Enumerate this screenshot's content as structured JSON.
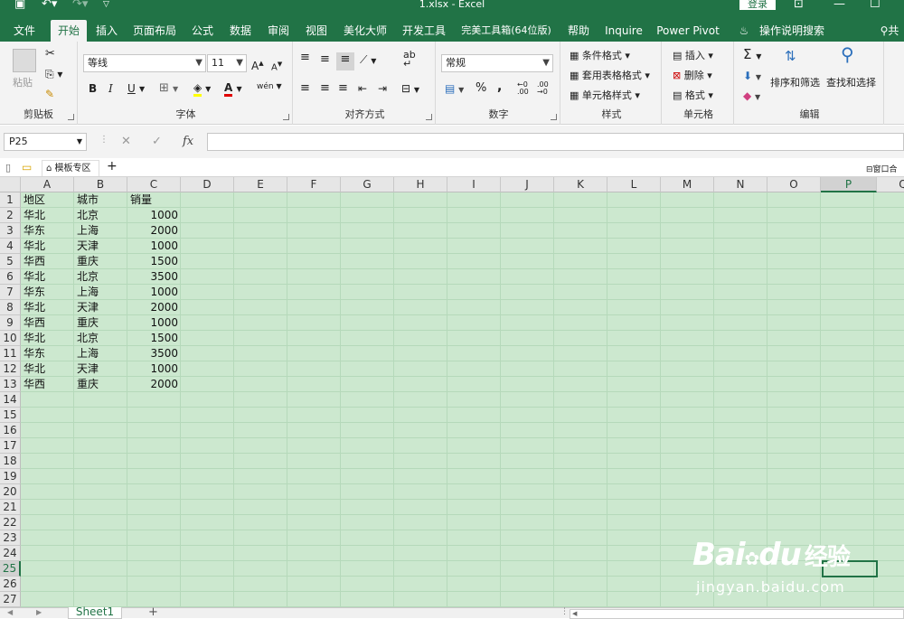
{
  "titlebar": {
    "title": "1.xlsx  -  Excel",
    "login": "登录"
  },
  "menu": {
    "tabs": [
      "文件",
      "开始",
      "插入",
      "页面布局",
      "公式",
      "数据",
      "审阅",
      "视图",
      "美化大师",
      "开发工具",
      "完美工具箱(64位版)",
      "帮助",
      "Inquire",
      "Power Pivot"
    ],
    "active": "开始",
    "search": "操作说明搜索",
    "share": "共"
  },
  "ribbon": {
    "clipboard": {
      "label": "剪贴板",
      "paste": "粘贴"
    },
    "font": {
      "label": "字体",
      "family": "等线",
      "size": "11",
      "bold": "B",
      "italic": "I",
      "underline": "U",
      "grow": "A",
      "shrink": "A",
      "color_letter": "A",
      "phonetic": "wén"
    },
    "alignment": {
      "label": "对齐方式"
    },
    "number": {
      "label": "数字",
      "format": "常规",
      "percent": "%",
      "comma": ","
    },
    "styles": {
      "label": "样式",
      "conditional": "条件格式",
      "table": "套用表格格式",
      "cell": "单元格样式"
    },
    "cells": {
      "label": "单元格",
      "insert": "插入",
      "delete": "删除",
      "format": "格式"
    },
    "editing": {
      "label": "编辑",
      "sort": "排序和筛选",
      "find": "查找和选择"
    }
  },
  "formula_bar": {
    "name_box": "P25",
    "cancel": "✕",
    "enter": "✓",
    "fx": "fx",
    "value": ""
  },
  "doc_bar": {
    "template_tab": "模板专区",
    "new_tab": "+",
    "window_label": "窗口合"
  },
  "sheet": {
    "columns": [
      "A",
      "B",
      "C",
      "D",
      "E",
      "F",
      "G",
      "H",
      "I",
      "J",
      "K",
      "L",
      "M",
      "N",
      "O",
      "P",
      "Q"
    ],
    "selected_column": "P",
    "selected_row": "25",
    "rows": [
      "1",
      "2",
      "3",
      "4",
      "5",
      "6",
      "7",
      "8",
      "9",
      "10",
      "11",
      "12",
      "13",
      "14",
      "15",
      "16",
      "17",
      "18",
      "19",
      "20",
      "21",
      "22",
      "23",
      "24",
      "25",
      "26",
      "27"
    ],
    "headers": [
      "地区",
      "城市",
      "销量"
    ],
    "data": [
      [
        "华北",
        "北京",
        "1000"
      ],
      [
        "华东",
        "上海",
        "2000"
      ],
      [
        "华北",
        "天津",
        "1000"
      ],
      [
        "华西",
        "重庆",
        "1500"
      ],
      [
        "华北",
        "北京",
        "3500"
      ],
      [
        "华东",
        "上海",
        "1000"
      ],
      [
        "华北",
        "天津",
        "2000"
      ],
      [
        "华西",
        "重庆",
        "1000"
      ],
      [
        "华北",
        "北京",
        "1500"
      ],
      [
        "华东",
        "上海",
        "3500"
      ],
      [
        "华北",
        "天津",
        "1000"
      ],
      [
        "华西",
        "重庆",
        "2000"
      ]
    ]
  },
  "sheet_tabs": {
    "active": "Sheet1",
    "add": "+"
  },
  "watermark": {
    "logo_a": "Bai",
    "logo_b": "du",
    "brand_cn": "经验",
    "url": "jingyan.baidu.com"
  }
}
